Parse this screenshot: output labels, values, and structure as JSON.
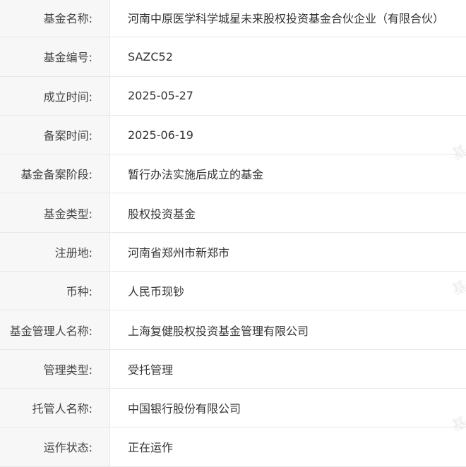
{
  "fund_info": {
    "rows": [
      {
        "label": "基金名称:",
        "value": "河南中原医学科学城星未来股权投资基金合伙企业（有限合伙）"
      },
      {
        "label": "基金编号:",
        "value": "SAZC52"
      },
      {
        "label": "成立时间:",
        "value": "2025-05-27"
      },
      {
        "label": "备案时间:",
        "value": "2025-06-19"
      },
      {
        "label": "基金备案阶段:",
        "value": "暂行办法实施后成立的基金"
      },
      {
        "label": "基金类型:",
        "value": "股权投资基金"
      },
      {
        "label": "注册地:",
        "value": "河南省郑州市新郑市"
      },
      {
        "label": "币种:",
        "value": "人民币现钞"
      },
      {
        "label": "基金管理人名称:",
        "value": "上海复健股权投资基金管理有限公司"
      },
      {
        "label": "管理类型:",
        "value": "受托管理"
      },
      {
        "label": "托管人名称:",
        "value": "中国银行股份有限公司"
      },
      {
        "label": "运作状态:",
        "value": "正在运作"
      }
    ]
  },
  "watermark": {
    "text": "基"
  }
}
